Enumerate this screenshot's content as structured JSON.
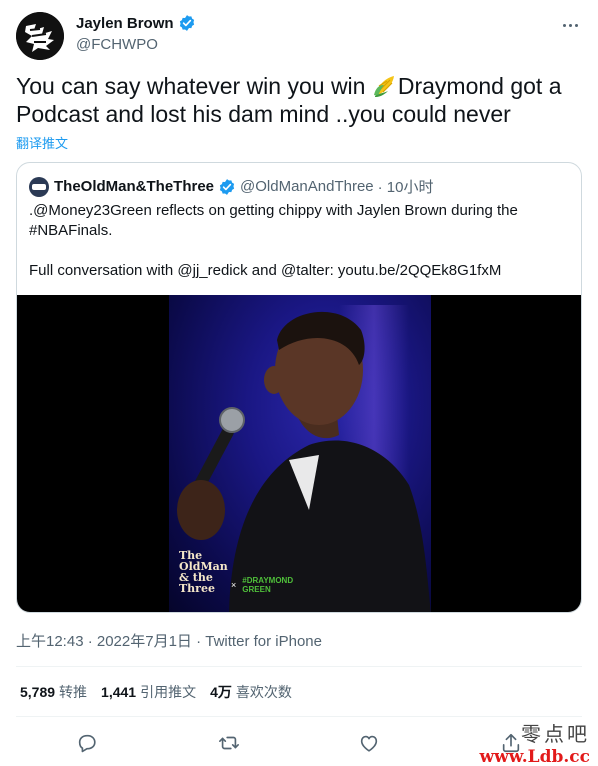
{
  "author": {
    "name": "Jaylen Brown",
    "handle": "@FCHWPO"
  },
  "tweet": {
    "text_before": "You can say whatever win you win ",
    "text_after": "Draymond got a Podcast and lost his dam mind ..you could never",
    "translate_label": "翻译推文"
  },
  "quote": {
    "name": "TheOldMan&TheThree",
    "handle": "@OldManAndThree",
    "time": "· 10小时",
    "line1": ".@Money23Green reflects on getting chippy with Jaylen Brown during the #NBAFinals.",
    "line2": "Full conversation with @jj_redick and @talter: youtu.be/2QQEk8G1fxM",
    "watermark_show": "The OldMan & the Three",
    "watermark_x": "×",
    "watermark_guest": "#DRAYMOND GREEN"
  },
  "meta": {
    "time": "上午12:43 · 2022年7月1日 · ",
    "source": "Twitter for iPhone"
  },
  "stats": {
    "retweets": "5,789",
    "retweets_label": "转推",
    "quotes": "1,441",
    "quotes_label": "引用推文",
    "likes": "4万",
    "likes_label": "喜欢次数"
  },
  "site_watermark": {
    "cn": "零点吧",
    "url": "www.Ldb.cc"
  },
  "colors": {
    "accent": "#1d9bf0",
    "text": "#0f1419",
    "muted": "#536471"
  },
  "icons": [
    "verified-icon",
    "more-icon",
    "corn-icon",
    "reply-icon",
    "retweet-icon",
    "like-icon",
    "share-icon"
  ]
}
